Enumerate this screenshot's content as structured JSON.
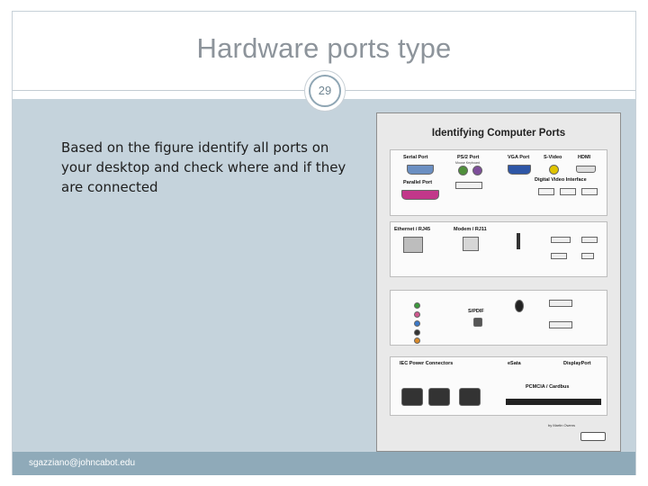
{
  "slide": {
    "title": "Hardware ports type",
    "page_number": "29",
    "body_text": "Based on the figure identify all ports on your desktop and check where and if they are connected",
    "footer": "sgazziano@johncabot.edu"
  },
  "figure": {
    "title": "Identifying Computer Ports",
    "labels": {
      "serial": "Serial Port",
      "ps2": "PS/2 Port",
      "ps2_sub": "Mouse   Keyboard",
      "vga": "VGA Port",
      "svideo": "S-Video",
      "hdmi": "HDMI",
      "parallel": "Parallel Port",
      "dvi": "Digital Video Interface",
      "ethernet": "Ethernet / RJ45",
      "modem": "Modem / RJ11",
      "spdif": "S/PDIF",
      "iec": "IEC Power Connectors",
      "esata": "eSata",
      "displayport": "DisplayPort",
      "pcmcia": "PCMCIA / Cardbus"
    },
    "credit": "by Martin Owens",
    "colors": {
      "ps2_mouse": "#4f8f3a",
      "ps2_keyboard": "#7d4e9a",
      "vga": "#2e56a6",
      "svideo": "#e0c400",
      "parallel": "#c2378a",
      "audio_green": "#3c9a3c",
      "audio_pink": "#d0578e",
      "audio_blue": "#3c79c9"
    }
  }
}
